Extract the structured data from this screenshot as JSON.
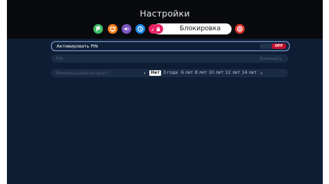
{
  "header": {
    "title": "Настройки"
  },
  "tabs": [
    {
      "icon": "flag-icon",
      "color": "#3fba66"
    },
    {
      "icon": "tv-icon",
      "color": "#ff7f1e"
    },
    {
      "icon": "speaker-icon",
      "color": "#7e57c2"
    },
    {
      "icon": "clock-icon",
      "color": "#1e88e5"
    },
    {
      "icon": "brush-icon",
      "color": "#e91e63"
    }
  ],
  "active_tab": {
    "label": "Блокировка",
    "icon": "lock-icon",
    "color": "#e91e63"
  },
  "extra_tab": {
    "icon": "lifebuoy-icon",
    "color": "#e53935"
  },
  "settings": {
    "pin_toggle": {
      "label": "Активировать PIN",
      "state": "OFF",
      "state_color": "#c8102e"
    },
    "pin": {
      "label": "PIN",
      "action": "Изменить"
    },
    "min_age": {
      "label": "Минимальный возраст",
      "options": [
        "Нет",
        "3 года",
        "6 лет",
        "8 лет",
        "10 лет",
        "12 лет",
        "14 лет"
      ],
      "selected": "Нет",
      "prev_arrow": "‹",
      "next_arrow": "›"
    }
  }
}
